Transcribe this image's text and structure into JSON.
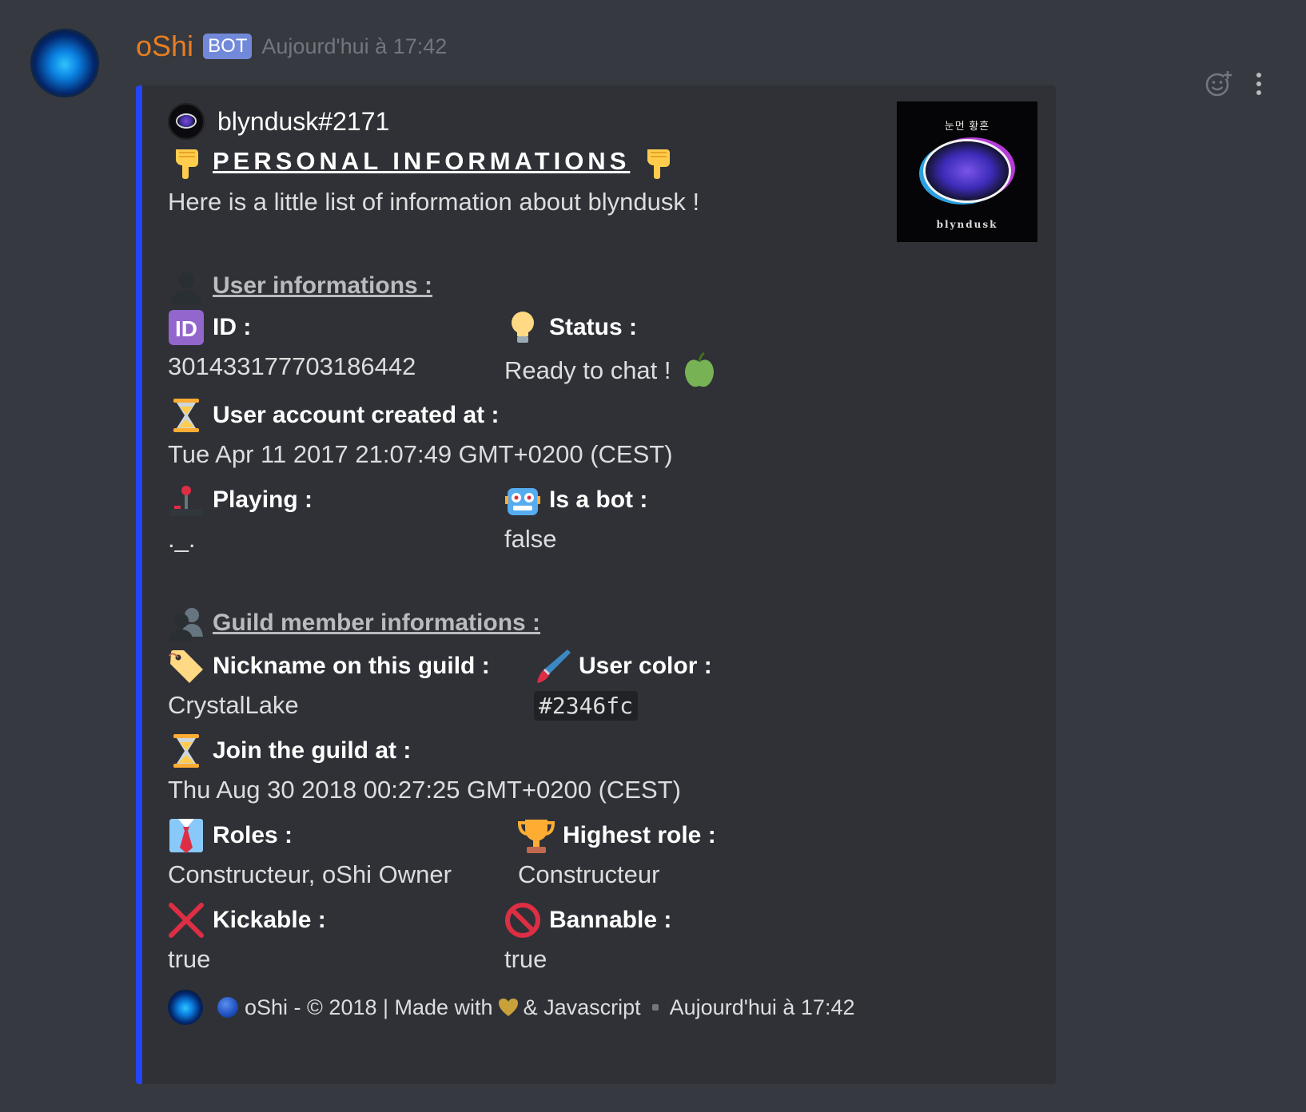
{
  "message": {
    "username": "oShi",
    "bot_tag": "BOT",
    "timestamp": "Aujourd'hui à 17:42",
    "username_color": "#e67e22"
  },
  "actions": {
    "icons": [
      "add-reaction-icon",
      "more-options-icon"
    ]
  },
  "embed": {
    "color": "#2346fc",
    "author": "blyndusk#2171",
    "title": "PERSONAL INFORMATIONS",
    "title_emoji": "pointing-down-emoji",
    "description": "Here is a little list of information about blyndusk !",
    "thumbnail": {
      "korean_text": "눈먼 황혼",
      "name_text": "blyndusk"
    },
    "user_section": "User informations :",
    "guild_section": "Guild member informations :",
    "fields": {
      "id": {
        "name": "ID :",
        "value": "301433177703186442",
        "icon": "id-emoji"
      },
      "status": {
        "name": "Status :",
        "value": "Ready to chat !",
        "icon": "light-bulb-emoji",
        "value_icon": "green-apple-emoji"
      },
      "created": {
        "name": "User account created at :",
        "value": "Tue Apr 11 2017 21:07:49 GMT+0200 (CEST)",
        "icon": "hourglass-emoji"
      },
      "playing": {
        "name": "Playing :",
        "value": "._.",
        "icon": "joystick-emoji"
      },
      "is_bot": {
        "name": "Is a bot :",
        "value": "false",
        "icon": "robot-emoji"
      },
      "nickname": {
        "name": "Nickname on this guild :",
        "value": "CrystalLake",
        "icon": "label-tag-emoji"
      },
      "user_color": {
        "name": "User color :",
        "value": "#2346fc",
        "icon": "paintbrush-emoji"
      },
      "joined": {
        "name": "Join the guild at :",
        "value": "Thu Aug 30 2018 00:27:25 GMT+0200 (CEST)",
        "icon": "hourglass-emoji"
      },
      "roles": {
        "name": "Roles :",
        "value": "Constructeur, oShi Owner",
        "icon": "shirt-tie-emoji"
      },
      "highest_role": {
        "name": "Highest role :",
        "value": "Constructeur",
        "icon": "trophy-emoji"
      },
      "kickable": {
        "name": "Kickable :",
        "value": "true",
        "icon": "cross-mark-emoji"
      },
      "bannable": {
        "name": "Bannable :",
        "value": "true",
        "icon": "prohibited-emoji"
      }
    },
    "footer": {
      "text_a": "oShi - © 2018 | Made with",
      "text_b": "& Javascript",
      "timestamp": "Aujourd'hui à 17:42"
    }
  }
}
